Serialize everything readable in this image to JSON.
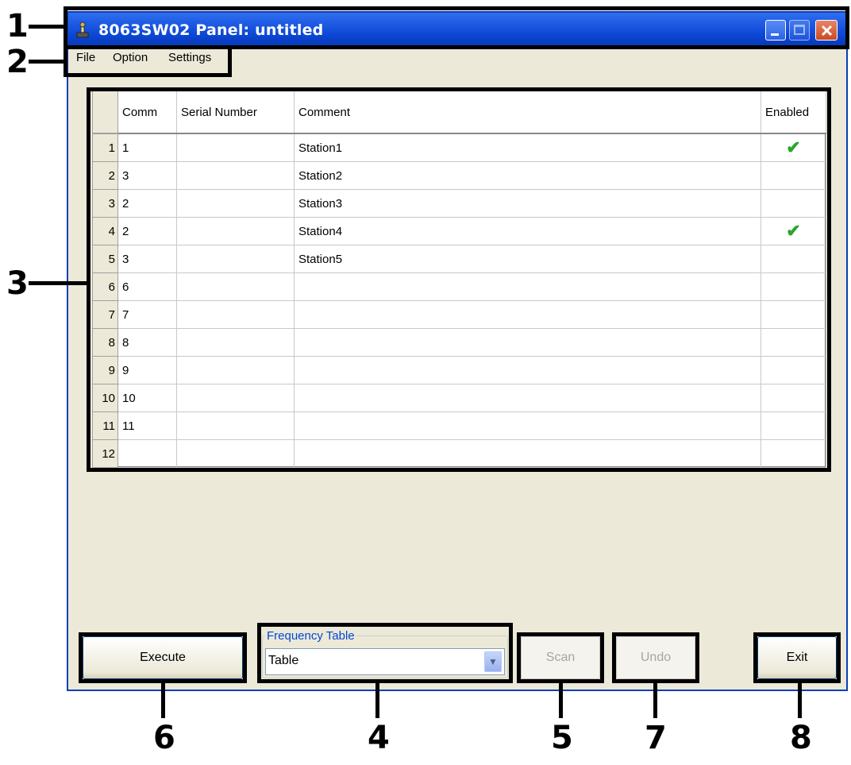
{
  "window": {
    "title": "8063SW02 Panel: untitled"
  },
  "menu": [
    "File",
    "Option",
    "Settings"
  ],
  "grid": {
    "columns": [
      "Comm",
      "Serial Number",
      "Comment",
      "Enabled"
    ],
    "rows": [
      {
        "num": "1",
        "comm": "1",
        "serial": "",
        "comment": "Station1",
        "enabled": "✔"
      },
      {
        "num": "2",
        "comm": "3",
        "serial": "",
        "comment": "Station2",
        "enabled": ""
      },
      {
        "num": "3",
        "comm": "2",
        "serial": "",
        "comment": "Station3",
        "enabled": ""
      },
      {
        "num": "4",
        "comm": "2",
        "serial": "",
        "comment": "Station4",
        "enabled": "✔"
      },
      {
        "num": "5",
        "comm": "3",
        "serial": "",
        "comment": "Station5",
        "enabled": ""
      },
      {
        "num": "6",
        "comm": "6",
        "serial": "",
        "comment": "",
        "enabled": ""
      },
      {
        "num": "7",
        "comm": "7",
        "serial": "",
        "comment": "",
        "enabled": ""
      },
      {
        "num": "8",
        "comm": "8",
        "serial": "",
        "comment": "",
        "enabled": ""
      },
      {
        "num": "9",
        "comm": "9",
        "serial": "",
        "comment": "",
        "enabled": ""
      },
      {
        "num": "10",
        "comm": "10",
        "serial": "",
        "comment": "",
        "enabled": ""
      },
      {
        "num": "11",
        "comm": "11",
        "serial": "",
        "comment": "",
        "enabled": ""
      },
      {
        "num": "12",
        "comm": "",
        "serial": "",
        "comment": "",
        "enabled": ""
      }
    ]
  },
  "controls": {
    "execute": "Execute",
    "frequency_legend": "Frequency Table",
    "frequency_value": "Table",
    "scan": "Scan",
    "undo": "Undo",
    "exit": "Exit"
  },
  "callouts": {
    "title_bar": "1",
    "menu_bar": "2",
    "grid": "3",
    "frequency_table": "4",
    "scan": "5",
    "execute": "6",
    "undo": "7",
    "exit": "8"
  },
  "colors": {
    "title_bar": "#0b45d3",
    "check": "#2aa52a",
    "window_bg": "#ece9d8"
  }
}
